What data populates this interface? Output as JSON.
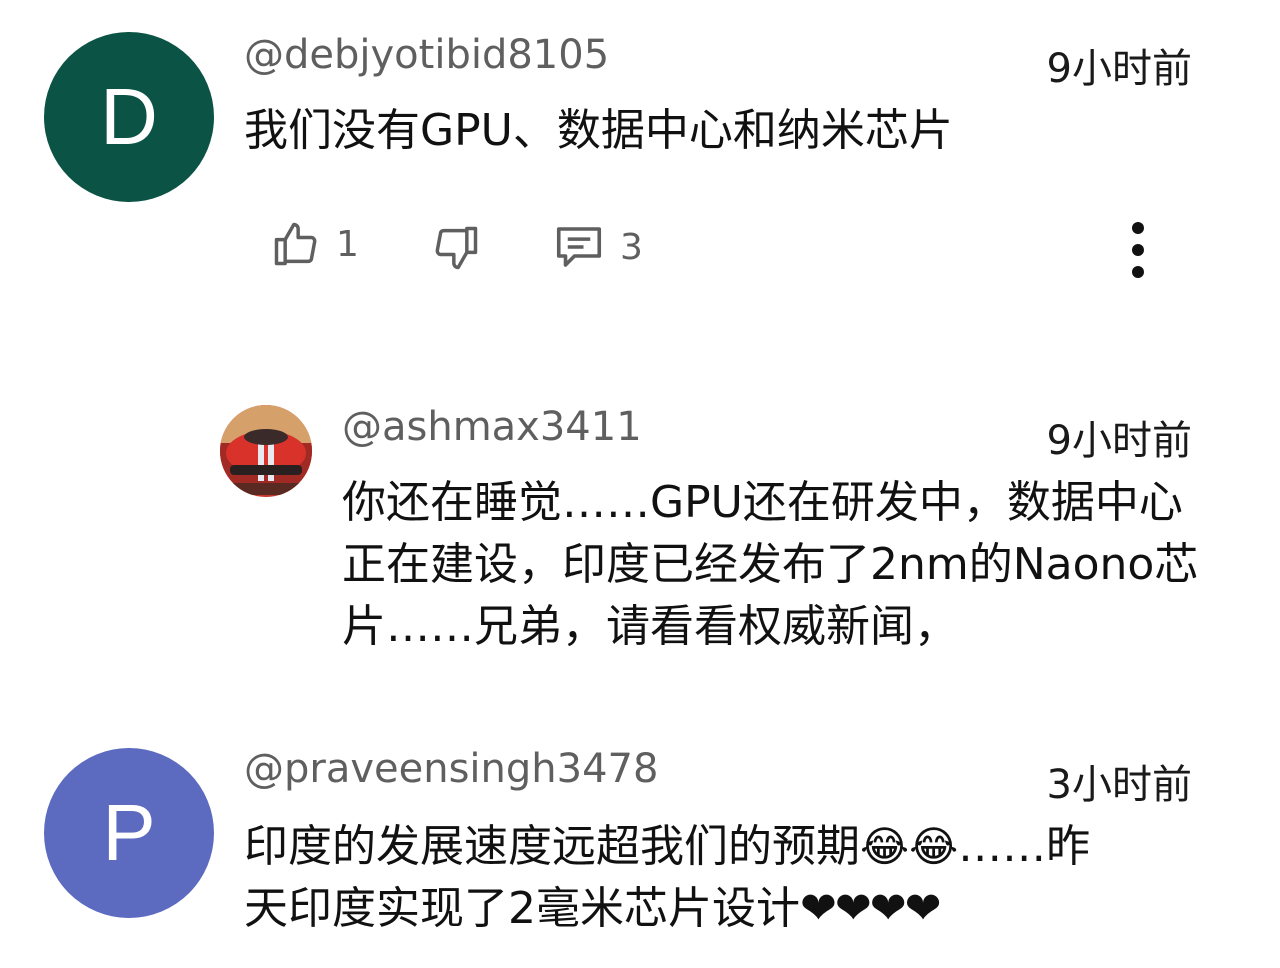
{
  "comments": [
    {
      "avatar_letter": "D",
      "avatar_color": "#0b5345",
      "handle": "@debjyotibid8105",
      "time": "9小时前",
      "text": "我们没有GPU、数据中心和纳米芯片",
      "likes": "1",
      "replies": "3"
    },
    {
      "handle": "@ashmax3411",
      "time": "9小时前",
      "text": "你还在睡觉……GPU还在研发中，数据中心正在建设，印度已经发布了2nm的Naono芯片……兄弟，请看看权威新闻，"
    },
    {
      "avatar_letter": "P",
      "avatar_color": "#5c6bc0",
      "handle": "@praveensingh3478",
      "time": "3小时前",
      "text_line1": "印度的发展速度远超我们的预期",
      "emoji": "😂😂",
      "text_line1_tail": "……昨",
      "text_line2": "天印度实现了2毫米芯片设计",
      "hearts": "❤❤❤❤"
    }
  ],
  "icons": {
    "like": "thumbs-up-icon",
    "dislike": "thumbs-down-icon",
    "reply": "comment-icon",
    "more": "more-vert-icon"
  }
}
